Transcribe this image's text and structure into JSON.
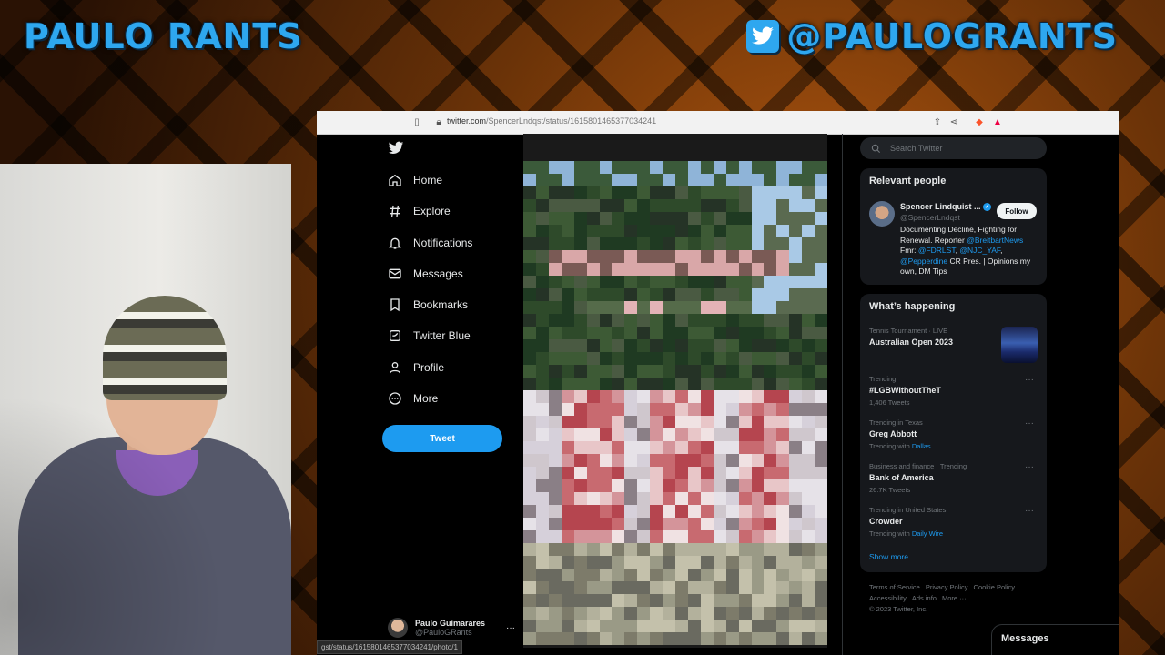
{
  "overlay": {
    "left_title": "PAULO RANTS",
    "right_handle": "@PAULOGRANTS",
    "twitter_icon": "twitter-bird-icon",
    "accent": "#2ea7ef"
  },
  "browser": {
    "url_host": "twitter.com",
    "url_path": "/SpencerLndqst/status/1615801465377034241",
    "status_link": "gst/status/1615801465377034241/photo/1"
  },
  "sidebar": {
    "items": [
      {
        "label": "Home",
        "icon": "home-icon"
      },
      {
        "label": "Explore",
        "icon": "hashtag-icon"
      },
      {
        "label": "Notifications",
        "icon": "bell-icon"
      },
      {
        "label": "Messages",
        "icon": "envelope-icon"
      },
      {
        "label": "Bookmarks",
        "icon": "bookmark-icon"
      },
      {
        "label": "Twitter Blue",
        "icon": "twitter-blue-icon"
      },
      {
        "label": "Profile",
        "icon": "person-icon"
      },
      {
        "label": "More",
        "icon": "more-circle-icon"
      }
    ],
    "tweet_button": "Tweet",
    "account": {
      "name": "Paulo Guimarares",
      "handle": "@PauloGRants",
      "more": "···"
    }
  },
  "search": {
    "placeholder": "Search Twitter"
  },
  "relevant_people": {
    "title": "Relevant people",
    "name": "Spencer Lindquist ...",
    "handle": "@SpencerLndqst",
    "follow_label": "Follow",
    "bio_1": "Documenting Decline, Fighting for Renewal. Reporter ",
    "bio_link_1": "@BreitbartNews",
    "bio_2": " Fmr: ",
    "bio_link_2": "@FDRLST",
    "bio_3": ", ",
    "bio_link_3": "@NJC_YAF",
    "bio_4": ", ",
    "bio_link_4": "@Pepperdine",
    "bio_5": " CR Pres. | Opinions my own, DM Tips"
  },
  "happening": {
    "title": "What’s happening",
    "trends": [
      {
        "meta": "Tennis Tournament · LIVE",
        "name": "Australian Open 2023",
        "sub": "",
        "sub_link": ""
      },
      {
        "meta": "Trending",
        "name": "#LGBWithoutTheT",
        "sub": "1,406 Tweets",
        "sub_link": ""
      },
      {
        "meta": "Trending in Texas",
        "name": "Greg Abbott",
        "sub": "Trending with ",
        "sub_link": "Dallas"
      },
      {
        "meta": "Business and finance · Trending",
        "name": "Bank of America",
        "sub": "26.7K Tweets",
        "sub_link": ""
      },
      {
        "meta": "Trending in United States",
        "name": "Crowder",
        "sub": "Trending with ",
        "sub_link": "Daily Wire"
      }
    ],
    "show_more": "Show more"
  },
  "footer": {
    "links": [
      "Terms of Service",
      "Privacy Policy",
      "Cookie Policy",
      "Accessibility",
      "Ads info",
      "More ···"
    ],
    "copyright": "© 2023 Twitter, Inc."
  },
  "messages_drawer": "Messages",
  "colors": {
    "twitter_blue": "#1d9bf0",
    "bg": "#000000",
    "card": "#16181c"
  }
}
